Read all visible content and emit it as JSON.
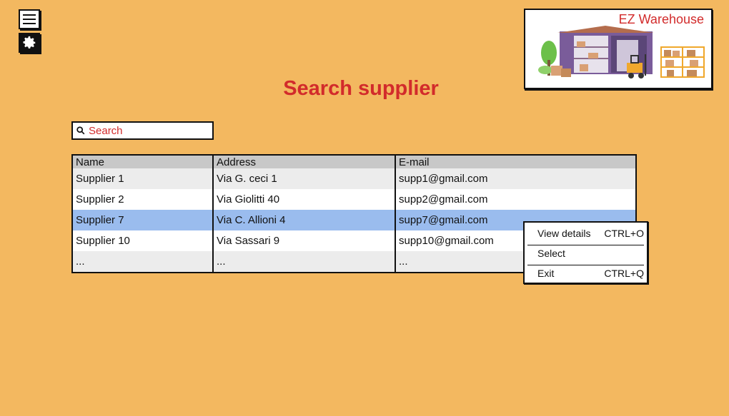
{
  "sidebar": {
    "menu_icon": "hamburger-menu-icon",
    "settings_icon": "gear-icon"
  },
  "logo": {
    "title": "EZ Warehouse"
  },
  "page": {
    "title": "Search supplier"
  },
  "search": {
    "placeholder": "Search",
    "icon": "search-icon"
  },
  "table": {
    "columns": [
      "Name",
      "Address",
      "E-mail"
    ],
    "rows": [
      {
        "name": "Supplier 1",
        "address": "Via G. ceci 1",
        "email": "supp1@gmail.com"
      },
      {
        "name": "Supplier 2",
        "address": "Via Giolitti 40",
        "email": "supp2@gmail.com"
      },
      {
        "name": "Supplier 7",
        "address": "Via C. Allioni 4",
        "email": "supp7@gmail.com",
        "selected": true
      },
      {
        "name": "Supplier 10",
        "address": "Via Sassari 9",
        "email": "supp10@gmail.com"
      },
      {
        "name": "...",
        "address": "...",
        "email": "..."
      }
    ]
  },
  "context_menu": {
    "items": [
      {
        "label": "View details",
        "shortcut": "CTRL+O"
      },
      {
        "label": "Select",
        "shortcut": ""
      },
      {
        "label": "Exit",
        "shortcut": "CTRL+Q"
      }
    ]
  },
  "colors": {
    "background": "#f3b860",
    "accent": "#d22b2b",
    "selected_row": "#9abcee",
    "header": "#c8c8c8"
  }
}
